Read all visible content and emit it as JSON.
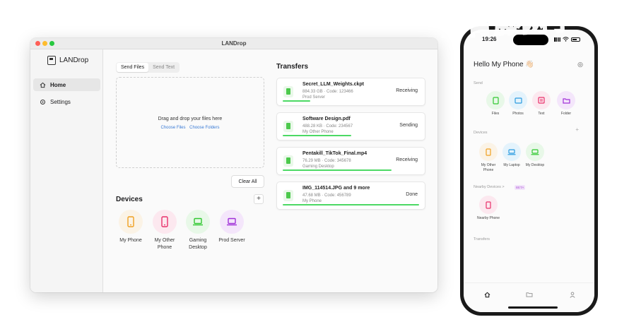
{
  "watermark": "常青藤网子",
  "window": {
    "title": "LANDrop"
  },
  "sidebar": {
    "brand": "LANDrop",
    "items": [
      {
        "label": "Home",
        "icon": "home-icon",
        "active": true
      },
      {
        "label": "Settings",
        "icon": "gear-icon",
        "active": false
      }
    ]
  },
  "send": {
    "tabs": [
      "Send Files",
      "Send Text"
    ],
    "active_tab": "Send Files",
    "drop_title": "Drag and drop your files here",
    "choose_files": "Choose Files",
    "choose_folders": "Choose Folders",
    "clear_all": "Clear All"
  },
  "devices": {
    "title": "Devices",
    "add": "+",
    "items": [
      {
        "label": "My Phone",
        "icon": "phone-icon",
        "color": "#f0a020",
        "bg": "#fbf3e6"
      },
      {
        "label": "My Other Phone",
        "icon": "phone-icon",
        "color": "#e8306a",
        "bg": "#fce8ef"
      },
      {
        "label": "Gaming Desktop",
        "icon": "laptop-icon",
        "color": "#30c830",
        "bg": "#e8f8e8"
      },
      {
        "label": "Prod Server",
        "icon": "laptop-icon",
        "color": "#a030d8",
        "bg": "#f4e6fb"
      }
    ]
  },
  "transfers": {
    "title": "Transfers",
    "items": [
      {
        "name": "Secret_LLM_Weights.ckpt",
        "meta": "884.33 GB · Code: 123466",
        "device": "Prod Server",
        "status": "Receiving",
        "progress": 0.2
      },
      {
        "name": "Software Design.pdf",
        "meta": "488.28 KB · Code: 234567",
        "device": "My Other Phone",
        "status": "Sending",
        "progress": 0.5
      },
      {
        "name": "Pentakill_TikTok_Final.mp4",
        "meta": "76.29 MB · Code: 345678",
        "device": "Gaming Desktop",
        "status": "Receiving",
        "progress": 0.8
      },
      {
        "name": "IMG_114514.JPG and 9 more",
        "meta": "47.68 MB · Code: 456789",
        "device": "My Phone",
        "status": "Done",
        "progress": 1.0
      }
    ]
  },
  "phone": {
    "time": "19:26",
    "greeting": "Hello My Phone 👋🏻",
    "send_label": "Send",
    "send_items": [
      {
        "label": "Files",
        "color": "#30c830",
        "bg": "#e8f8e8"
      },
      {
        "label": "Photos",
        "color": "#2a9be0",
        "bg": "#e4f3fc"
      },
      {
        "label": "Text",
        "color": "#e8306a",
        "bg": "#fce8ef"
      },
      {
        "label": "Folder",
        "color": "#a030d8",
        "bg": "#f4e6fb"
      }
    ],
    "devices_label": "Devices",
    "devices_add": "+",
    "devices": [
      {
        "label": "My Other Phone",
        "color": "#f0a020",
        "bg": "#fbf3e6"
      },
      {
        "label": "My Laptop",
        "color": "#2a9be0",
        "bg": "#e4f3fc"
      },
      {
        "label": "My Desktop",
        "color": "#30c830",
        "bg": "#e8f8e8"
      }
    ],
    "nearby_label": "Nearby Devices",
    "nearby_chevron": ">",
    "beta": "BETA",
    "nearby": [
      {
        "label": "Nearby Phone",
        "color": "#e8306a",
        "bg": "#fce8ef"
      }
    ],
    "transfers_label": "Transfers"
  }
}
